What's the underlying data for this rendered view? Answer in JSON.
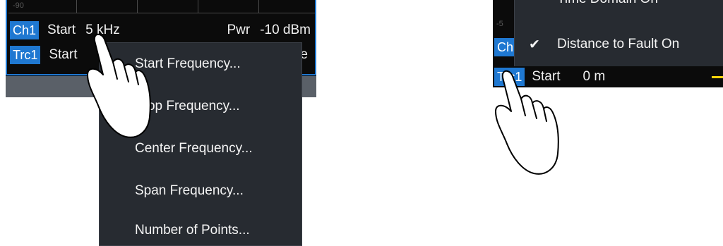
{
  "left_panel": {
    "grid_tick": "-90",
    "row1": {
      "channel": "Ch1",
      "start_label": "Start",
      "start_value": "5 kHz",
      "pwr_label": "Pwr",
      "pwr_value": "-10 dBm"
    },
    "row2": {
      "trace": "Trc1",
      "start_label": "Start",
      "trailing_char": "e"
    },
    "context_menu": {
      "items": [
        "Start Frequency...",
        "Stop Frequency...",
        "Center Frequency...",
        "Span Frequency...",
        "Number of Points..."
      ]
    }
  },
  "right_panel": {
    "menu_items": [
      {
        "label": "Time Domain On",
        "checked": false
      },
      {
        "label": "Distance to Fault On",
        "checked": true
      }
    ],
    "checkmark": "✔",
    "row_prefix": "Ch",
    "trace_row": {
      "trace": "Trc1",
      "start_label": "Start",
      "start_value": "0 m"
    },
    "left_edge_tick": "-5"
  },
  "colors": {
    "accent": "#1f78d1",
    "menu_bg": "#272b31",
    "screen_bg": "#0b0b0b",
    "marker": "#ffd60a"
  }
}
